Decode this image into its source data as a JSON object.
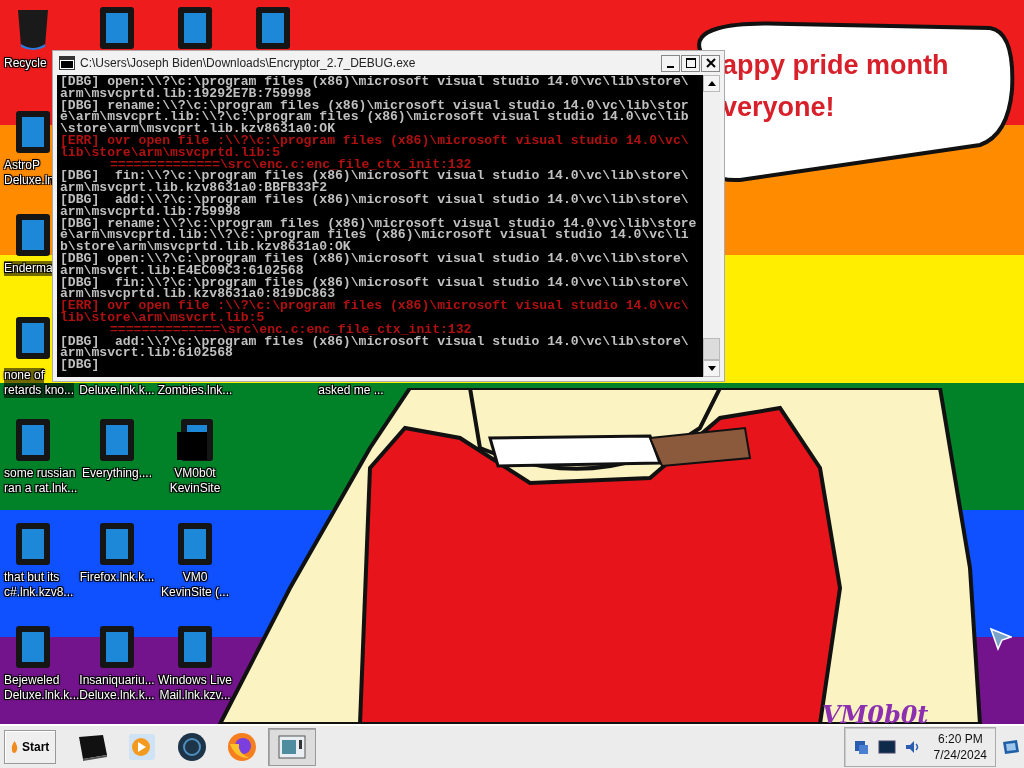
{
  "desktop_icons": [
    {
      "kind": "recycle-bin",
      "lines": [
        "Recycle"
      ]
    },
    {
      "kind": "shortcut"
    },
    {
      "kind": "shortcut"
    },
    {
      "kind": "shortcut"
    },
    {
      "kind": "shortcut",
      "lines": [
        "AstroP",
        "Deluxe.ln"
      ]
    },
    {
      "kind": "shortcut",
      "lines": [
        "Enderma"
      ]
    },
    {
      "kind": "shortcut",
      "lines": [
        "none of",
        "retards kno..."
      ]
    },
    {
      "kind": "covered",
      "lines": [
        "Deluxe.lnk.k..."
      ]
    },
    {
      "kind": "covered",
      "lines": [
        "Zombies.lnk..."
      ]
    },
    {
      "kind": "covered",
      "lines": [
        "asked me ..."
      ]
    },
    {
      "kind": "shortcut",
      "lines": [
        "some russian",
        "ran a rat.lnk..."
      ]
    },
    {
      "kind": "shortcut",
      "lines": [
        "Everything...."
      ]
    },
    {
      "kind": "redacted",
      "lines": [
        "VM0b0t",
        "KevinSite"
      ]
    },
    {
      "kind": "shortcut",
      "lines": [
        "that but its",
        "c#.lnk.kzv8..."
      ]
    },
    {
      "kind": "shortcut",
      "lines": [
        "Firefox.lnk.k..."
      ]
    },
    {
      "kind": "shortcut",
      "lines": [
        "VM0",
        "KevinSite (..."
      ]
    },
    {
      "kind": "shortcut",
      "lines": [
        "Bejeweled",
        "Deluxe.lnk.k..."
      ]
    },
    {
      "kind": "shortcut",
      "lines": [
        "Insaniquariu...",
        "Deluxe.lnk.k..."
      ]
    },
    {
      "kind": "shortcut",
      "lines": [
        "Windows Live",
        "Mail.lnk.kzv..."
      ]
    }
  ],
  "speech_bubble": {
    "lines": [
      "appy pride month",
      "veryone!"
    ]
  },
  "wallpaper_signature": "VM0b0t",
  "console_window": {
    "title": "C:\\Users\\Joseph Biden\\Downloads\\Encryptor_2.7_DEBUG.exe",
    "lines": [
      {
        "kind": "dbg",
        "text": "[DBG] open:\\\\?\\c:\\program files (x86)\\microsoft visual studio 14.0\\vc\\lib\\store\\"
      },
      {
        "kind": "dbg",
        "text": "arm\\msvcprtd.lib:19292E7B:759998"
      },
      {
        "kind": "dbg",
        "text": "[DBG] rename:\\\\?\\c:\\program files (x86)\\microsoft visual studio 14.0\\vc\\lib\\stor"
      },
      {
        "kind": "dbg",
        "text": "e\\arm\\msvcprt.lib:\\\\?\\c:\\program files (x86)\\microsoft visual studio 14.0\\vc\\lib"
      },
      {
        "kind": "dbg",
        "text": "\\store\\arm\\msvcprt.lib.kzv8631a0:OK"
      },
      {
        "kind": "err",
        "text": "[ERR] ovr open file :\\\\?\\c:\\program files (x86)\\microsoft visual studio 14.0\\vc\\"
      },
      {
        "kind": "err",
        "text": "lib\\store\\arm\\msvcprtd.lib:5"
      },
      {
        "kind": "err-indent",
        "text": "==============\\src\\enc.c:enc_file_ctx_init:132"
      },
      {
        "kind": "dbg",
        "text": "[DBG]  fin:\\\\?\\c:\\program files (x86)\\microsoft visual studio 14.0\\vc\\lib\\store\\"
      },
      {
        "kind": "dbg",
        "text": "arm\\msvcprt.lib.kzv8631a0:BBFB33F2"
      },
      {
        "kind": "dbg",
        "text": "[DBG]  add:\\\\?\\c:\\program files (x86)\\microsoft visual studio 14.0\\vc\\lib\\store\\"
      },
      {
        "kind": "dbg",
        "text": "arm\\msvcprtd.lib:759998"
      },
      {
        "kind": "dbg",
        "text": "[DBG] rename:\\\\?\\c:\\program files (x86)\\microsoft visual studio 14.0\\vc\\lib\\store"
      },
      {
        "kind": "dbg",
        "text": "e\\arm\\msvcprtd.lib:\\\\?\\c:\\program files (x86)\\microsoft visual studio 14.0\\vc\\li"
      },
      {
        "kind": "dbg",
        "text": "b\\store\\arm\\msvcprtd.lib.kzv8631a0:OK"
      },
      {
        "kind": "dbg",
        "text": "[DBG] open:\\\\?\\c:\\program files (x86)\\microsoft visual studio 14.0\\vc\\lib\\store\\"
      },
      {
        "kind": "dbg",
        "text": "arm\\msvcrt.lib:E4EC09C3:6102568"
      },
      {
        "kind": "dbg",
        "text": "[DBG]  fin:\\\\?\\c:\\program files (x86)\\microsoft visual studio 14.0\\vc\\lib\\store\\"
      },
      {
        "kind": "dbg",
        "text": "arm\\msvcprtd.lib.kzv8631a0:819DC863"
      },
      {
        "kind": "err",
        "text": "[ERR] ovr open file :\\\\?\\c:\\program files (x86)\\microsoft visual studio 14.0\\vc\\"
      },
      {
        "kind": "err",
        "text": "lib\\store\\arm\\msvcrt.lib:5"
      },
      {
        "kind": "err-indent",
        "text": "==============\\src\\enc.c:enc_file_ctx_init:132"
      },
      {
        "kind": "dbg",
        "text": "[DBG]  add:\\\\?\\c:\\program files (x86)\\microsoft visual studio 14.0\\vc\\lib\\store\\"
      },
      {
        "kind": "dbg",
        "text": "arm\\msvcrt.lib:6102568"
      },
      {
        "kind": "dbg",
        "text": "[DBG]"
      }
    ]
  },
  "taskbar": {
    "start_label": "Start",
    "items": [
      {
        "kind": "drive",
        "selected": false
      },
      {
        "kind": "media",
        "selected": false
      },
      {
        "kind": "globe",
        "selected": false
      },
      {
        "kind": "firefox",
        "selected": false
      },
      {
        "kind": "window",
        "selected": true
      }
    ],
    "time": "6:20 PM",
    "date": "7/24/2024"
  }
}
